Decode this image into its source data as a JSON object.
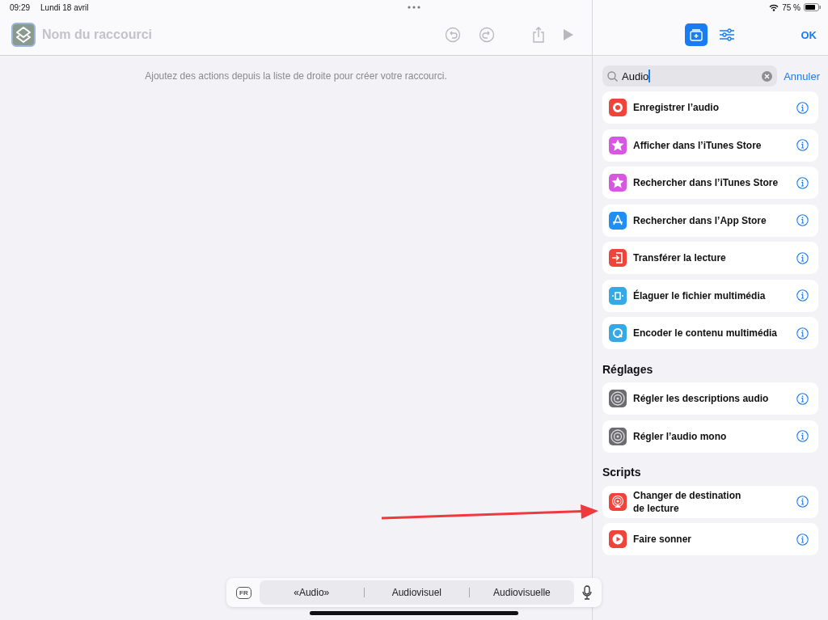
{
  "status_bar": {
    "time": "09:29",
    "date": "Lundi 18 avril",
    "battery": "75 %"
  },
  "editor": {
    "title_placeholder": "Nom du raccourci",
    "hint": "Ajoutez des actions depuis la liste de droite pour créer votre raccourci."
  },
  "panel": {
    "done": "OK",
    "search": {
      "value": "Audio",
      "cancel": "Annuler"
    },
    "sections": [
      {
        "items": [
          {
            "label": "Enregistrer l’audio",
            "kind": "record",
            "color": "#f0443a"
          },
          {
            "label": "Afficher dans l’iTunes Store",
            "kind": "star",
            "color": "#d757e0"
          },
          {
            "label": "Rechercher dans l’iTunes Store",
            "kind": "star",
            "color": "#d757e0"
          },
          {
            "label": "Rechercher dans l’App Store",
            "kind": "appstore",
            "color": "#1f8ef5"
          },
          {
            "label": "Transférer la lecture",
            "kind": "transfer",
            "color": "#f0443a"
          },
          {
            "label": "Élaguer le fichier multimédia",
            "kind": "trim",
            "color": "#35a8e6"
          },
          {
            "label": "Encoder le contenu multimédia",
            "kind": "encode",
            "color": "#35a8e6"
          }
        ]
      },
      {
        "title": "Réglages",
        "items": [
          {
            "label": "Régler les descriptions audio",
            "kind": "settings",
            "color": "#6b6b70"
          },
          {
            "label": "Régler l’audio mono",
            "kind": "settings",
            "color": "#6b6b70"
          }
        ]
      },
      {
        "title": "Scripts",
        "items": [
          {
            "label": "Changer de destination\nde lecture",
            "kind": "airplay",
            "color": "#f0443a"
          },
          {
            "label": "Faire sonner",
            "kind": "play",
            "color": "#f0443a"
          }
        ]
      }
    ]
  },
  "keyboard_bar": {
    "language": "FR",
    "suggestions": [
      "«Audio»",
      "Audiovisuel",
      "Audiovisuelle"
    ]
  }
}
